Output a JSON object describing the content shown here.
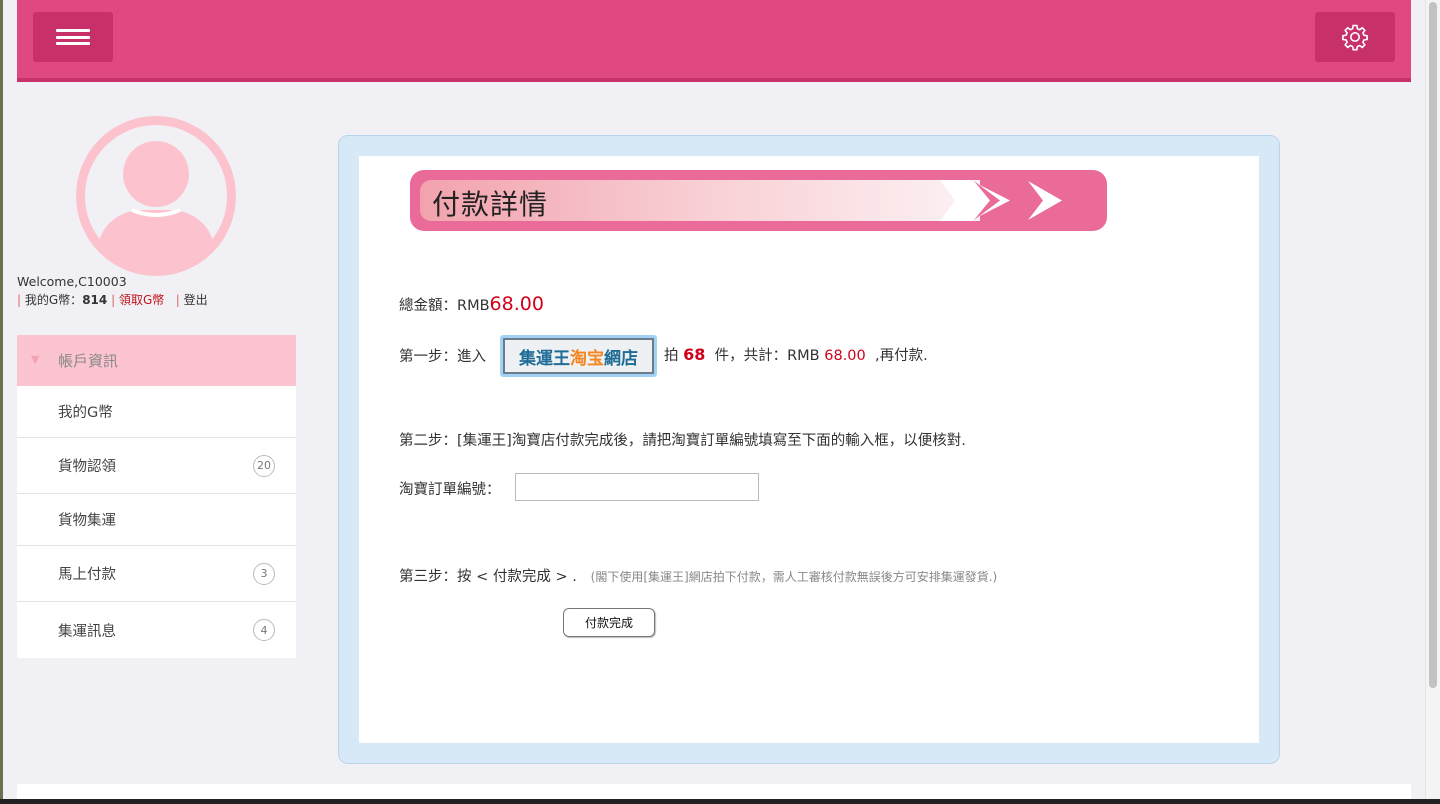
{
  "header": {
    "menu_icon": "hamburger-menu-icon",
    "settings_icon": "gear-icon",
    "accent": "#e04882"
  },
  "profile": {
    "welcome": "Welcome,C10003",
    "my_g_label": "我的G幣：",
    "my_g_value": "814",
    "claim_g": "領取G幣",
    "logout": "登出"
  },
  "sidebar": {
    "head": "帳戶資訊",
    "items": [
      {
        "label": "我的G幣",
        "badge": ""
      },
      {
        "label": "貨物認領",
        "badge": "20"
      },
      {
        "label": "貨物集運",
        "badge": ""
      },
      {
        "label": "馬上付款",
        "badge": "3"
      },
      {
        "label": "集運訊息",
        "badge": "4"
      }
    ]
  },
  "main": {
    "title": "付款詳情",
    "total_label": "總金額：RMB",
    "total_value": "68.00",
    "step1_prefix": "第一步：進入",
    "shop_btn": {
      "part1": "集運王",
      "part2": "淘宝",
      "part3": "網店"
    },
    "step1_mid": "拍",
    "step1_qty": "68",
    "step1_mid2": "件，共計：RMB",
    "step1_amount": "68.00",
    "step1_suffix": ",再付款.",
    "step2": "第二步：[集運王]淘寶店付款完成後，請把淘寶訂單編號填寫至下面的輸入框，以便核對.",
    "order_label": "淘寶訂單編號：",
    "order_value": "",
    "step3": "第三步：按 < 付款完成 > .",
    "step3_note": "(閣下使用[集運王]網店拍下付款，需人工審核付款無誤後方可安排集運發貨.)",
    "done_btn": "付款完成"
  }
}
